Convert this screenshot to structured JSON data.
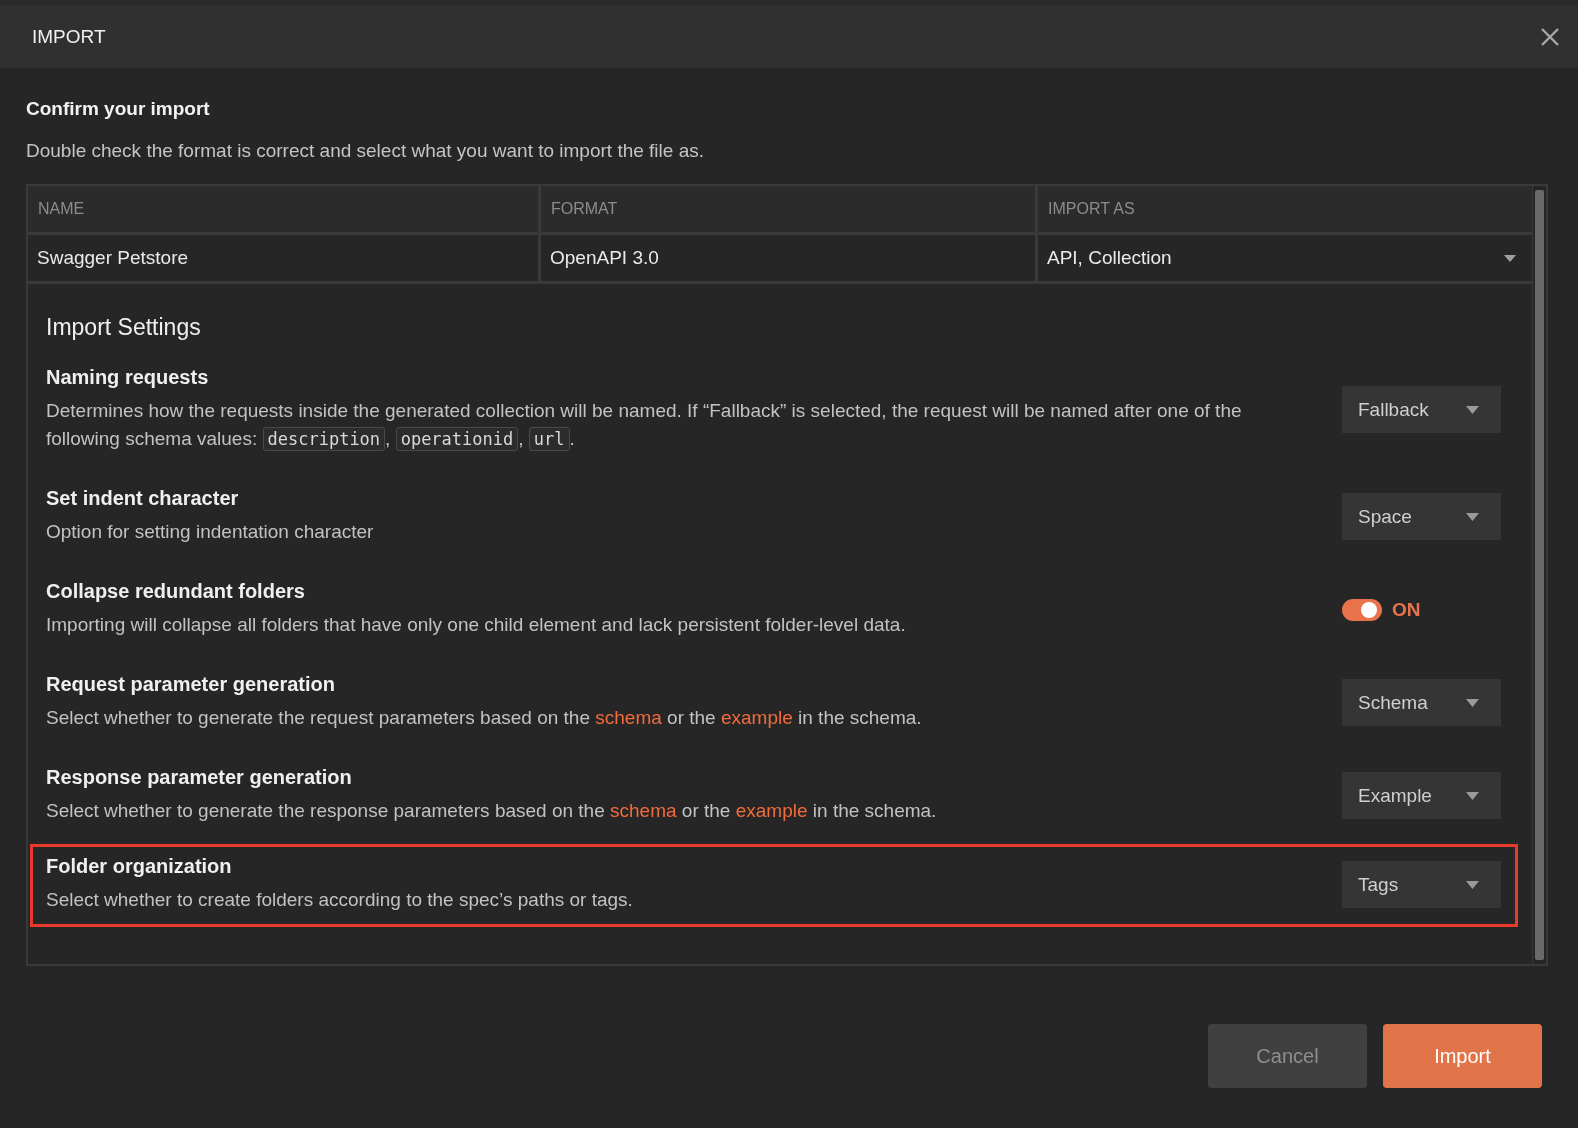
{
  "window": {
    "title": "IMPORT"
  },
  "heading": "Confirm your import",
  "subheading": "Double check the format is correct and select what you want to import the file as.",
  "table": {
    "columns": [
      "NAME",
      "FORMAT",
      "IMPORT AS"
    ],
    "rows": [
      {
        "cells": [
          {
            "kind": "text",
            "text": "Swagger Petstore"
          },
          {
            "kind": "text",
            "text": "OpenAPI 3.0"
          },
          {
            "kind": "dropdown",
            "text": "API, Collection"
          }
        ]
      }
    ]
  },
  "settings_title": "Import Settings",
  "settings": [
    {
      "title": "Naming requests",
      "highlighted": false,
      "description": [
        {
          "kind": "text",
          "text": "Determines how the requests inside the generated collection will be named. If “Fallback” is selected, the request will be named after one of the following schema values: "
        },
        {
          "kind": "code",
          "text": "description"
        },
        {
          "kind": "text",
          "text": ", "
        },
        {
          "kind": "code",
          "text": "operationid"
        },
        {
          "kind": "text",
          "text": ", "
        },
        {
          "kind": "code",
          "text": "url"
        },
        {
          "kind": "text",
          "text": "."
        }
      ],
      "control": {
        "kind": "dropdown",
        "value": "Fallback"
      }
    },
    {
      "title": "Set indent character",
      "highlighted": false,
      "description": [
        {
          "kind": "text",
          "text": "Option for setting indentation character"
        }
      ],
      "control": {
        "kind": "dropdown",
        "value": "Space"
      }
    },
    {
      "title": "Collapse redundant folders",
      "highlighted": false,
      "description": [
        {
          "kind": "text",
          "text": "Importing will collapse all folders that have only one child element and lack persistent folder-level data."
        }
      ],
      "control": {
        "kind": "toggle",
        "on": true,
        "label": "ON"
      }
    },
    {
      "title": "Request parameter generation",
      "highlighted": false,
      "description": [
        {
          "kind": "text",
          "text": "Select whether to generate the request parameters based on the "
        },
        {
          "kind": "link",
          "text": "schema"
        },
        {
          "kind": "text",
          "text": " or the "
        },
        {
          "kind": "link",
          "text": "example"
        },
        {
          "kind": "text",
          "text": " in the schema."
        }
      ],
      "control": {
        "kind": "dropdown",
        "value": "Schema"
      }
    },
    {
      "title": "Response parameter generation",
      "highlighted": false,
      "description": [
        {
          "kind": "text",
          "text": "Select whether to generate the response parameters based on the "
        },
        {
          "kind": "link",
          "text": "schema"
        },
        {
          "kind": "text",
          "text": " or the "
        },
        {
          "kind": "link",
          "text": "example"
        },
        {
          "kind": "text",
          "text": " in the schema."
        }
      ],
      "control": {
        "kind": "dropdown",
        "value": "Example"
      }
    },
    {
      "title": "Folder organization",
      "highlighted": true,
      "description": [
        {
          "kind": "text",
          "text": "Select whether to create folders according to the spec’s paths or tags."
        }
      ],
      "control": {
        "kind": "dropdown",
        "value": "Tags"
      }
    }
  ],
  "buttons": [
    {
      "label": "Cancel",
      "kind": "secondary"
    },
    {
      "label": "Import",
      "kind": "primary"
    }
  ]
}
